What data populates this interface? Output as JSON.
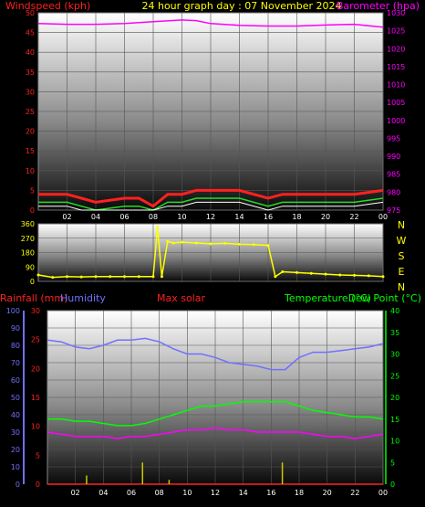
{
  "colors": {
    "wind": "#ff2020",
    "gust": "#22dd22",
    "windLight": "#ffffff",
    "baro": "#ff00ff",
    "title": "#ffff00",
    "dir": "#ffff00",
    "compass": "#ffff00",
    "rain": "#ff2020",
    "humidity": "#7070ff",
    "solar": "#ff2020",
    "temperature": "#00ff00",
    "dewpoint": "#00ff00",
    "solarBars": "#c8c800",
    "tick": "#ffffff",
    "tempAxis": "#00c000"
  },
  "header": {
    "wind_label": "Windspeed (kph)",
    "title": "24 hour graph day : 07 November 2024",
    "baro_label": "Barometer (hpa)"
  },
  "panel3_header": {
    "rain_label": "Rainfall (mm)",
    "humidity_label": "Humidity",
    "solar_label": "Max solar",
    "temperature_label": "Temperature (°C)",
    "dewpoint_label": "Dew Point (°C)"
  },
  "compass": [
    "N",
    "W",
    "S",
    "E",
    "N"
  ],
  "chart_data": [
    {
      "type": "line",
      "title": "24 hour graph day : 07 November 2024",
      "x_ticks": [
        "02",
        "04",
        "06",
        "08",
        "10",
        "12",
        "14",
        "16",
        "18",
        "20",
        "22",
        "00"
      ],
      "x_range": [
        0,
        24
      ],
      "left_axis": {
        "label": "Windspeed (kph)",
        "ylim": [
          0,
          50
        ],
        "ticks": [
          0,
          5,
          10,
          15,
          20,
          25,
          30,
          35,
          40,
          45,
          50
        ]
      },
      "right_axis": {
        "label": "Barometer (hpa)",
        "ylim": [
          975,
          1030
        ],
        "ticks": [
          975,
          980,
          985,
          990,
          995,
          1000,
          1005,
          1010,
          1015,
          1020,
          1025,
          1030
        ]
      },
      "grid": true,
      "series": [
        {
          "name": "Windspeed (kph)",
          "axis": "left",
          "x": [
            0,
            2,
            3,
            4,
            6,
            7,
            8,
            9,
            10,
            11,
            12,
            14,
            16,
            17,
            18,
            20,
            22,
            24
          ],
          "y": [
            4,
            4,
            3,
            2,
            3,
            3,
            1,
            4,
            4,
            5,
            5,
            5,
            3,
            4,
            4,
            4,
            4,
            5
          ]
        },
        {
          "name": "Barometer (hpa)",
          "axis": "right",
          "x": [
            0,
            2,
            4,
            6,
            8,
            10,
            11,
            12,
            14,
            16,
            18,
            20,
            22,
            24
          ],
          "y": [
            1027,
            1026.8,
            1026.8,
            1027,
            1027.5,
            1028,
            1027.8,
            1027,
            1026.5,
            1026.3,
            1026.3,
            1026.6,
            1026.8,
            1026
          ]
        }
      ]
    },
    {
      "type": "scatter",
      "title": "Wind direction",
      "x_range": [
        0,
        24
      ],
      "ylim": [
        0,
        360
      ],
      "y_ticks": [
        0,
        90,
        180,
        270,
        360
      ],
      "compass_labels": [
        "N",
        "W",
        "S",
        "E",
        "N"
      ],
      "series": [
        {
          "name": "Wind direction",
          "x": [
            0,
            1,
            2,
            3,
            4,
            5,
            6,
            7,
            8,
            8.3,
            8.6,
            9,
            9.4,
            10,
            11,
            12,
            13,
            14,
            15,
            16,
            16.5,
            17,
            18,
            19,
            20,
            21,
            22,
            23,
            24
          ],
          "y": [
            40,
            25,
            30,
            28,
            30,
            30,
            30,
            30,
            30,
            340,
            30,
            250,
            240,
            245,
            240,
            235,
            238,
            232,
            230,
            225,
            30,
            60,
            55,
            50,
            45,
            40,
            38,
            35,
            30
          ]
        }
      ]
    },
    {
      "type": "line",
      "title": "",
      "x_ticks": [
        "02",
        "04",
        "06",
        "08",
        "10",
        "12",
        "14",
        "16",
        "18",
        "20",
        "22",
        "00"
      ],
      "x_range": [
        0,
        24
      ],
      "axes": {
        "humidity": {
          "label": "Humidity",
          "ylim": [
            0,
            100
          ],
          "ticks": [
            0,
            10,
            20,
            30,
            40,
            50,
            60,
            70,
            80,
            90,
            100
          ]
        },
        "rainfall": {
          "label": "Rainfall (mm)",
          "ylim": [
            0,
            30
          ],
          "ticks": [
            0,
            5,
            10,
            15,
            20,
            25,
            30
          ]
        },
        "temperature": {
          "label": "Temperature (°C)",
          "ylim": [
            0,
            40
          ],
          "ticks": [
            0,
            5,
            10,
            15,
            20,
            25,
            30,
            35,
            40
          ]
        }
      },
      "grid": true,
      "series": [
        {
          "name": "Humidity",
          "axis": "humidity",
          "x": [
            0,
            1,
            2,
            3,
            4,
            5,
            6,
            7,
            8,
            9,
            10,
            11,
            12,
            13,
            14,
            15,
            16,
            17,
            18,
            19,
            20,
            21,
            22,
            23,
            24
          ],
          "y": [
            83,
            82,
            79,
            78,
            80,
            83,
            83,
            84,
            82,
            78,
            75,
            75,
            73,
            70,
            69,
            68,
            66,
            66,
            73,
            76,
            76,
            77,
            78,
            79,
            81
          ]
        },
        {
          "name": "Temperature (°C)",
          "axis": "temperature",
          "x": [
            0,
            1,
            2,
            3,
            4,
            5,
            6,
            7,
            8,
            9,
            10,
            11,
            12,
            13,
            14,
            15,
            16,
            17,
            18,
            19,
            20,
            21,
            22,
            23,
            24
          ],
          "y": [
            15,
            15,
            14.5,
            14.5,
            14,
            13.5,
            13.5,
            14,
            15,
            16,
            17,
            18,
            18,
            18.5,
            19,
            19,
            19,
            19,
            18,
            17,
            16.5,
            16,
            15.5,
            15.5,
            15
          ]
        },
        {
          "name": "Dew Point (°C)",
          "axis": "temperature",
          "x": [
            0,
            1,
            2,
            3,
            4,
            5,
            6,
            7,
            8,
            9,
            10,
            11,
            12,
            13,
            14,
            15,
            16,
            17,
            18,
            19,
            20,
            21,
            22,
            23,
            24
          ],
          "y": [
            12,
            11.5,
            11,
            11,
            11,
            10.5,
            11,
            11,
            11.5,
            12,
            12.5,
            12.5,
            13,
            12.5,
            12.5,
            12,
            12,
            12,
            12,
            11.5,
            11,
            11,
            10.5,
            11,
            11.5
          ]
        },
        {
          "name": "Rainfall (mm)",
          "axis": "rainfall",
          "x": [
            0,
            24
          ],
          "y": [
            0,
            0
          ]
        },
        {
          "name": "Max solar",
          "axis": "temperature",
          "type": "bar",
          "x": [
            2.8,
            6.8,
            8.7,
            16.8
          ],
          "y": [
            2,
            5,
            1,
            5
          ]
        }
      ]
    }
  ]
}
